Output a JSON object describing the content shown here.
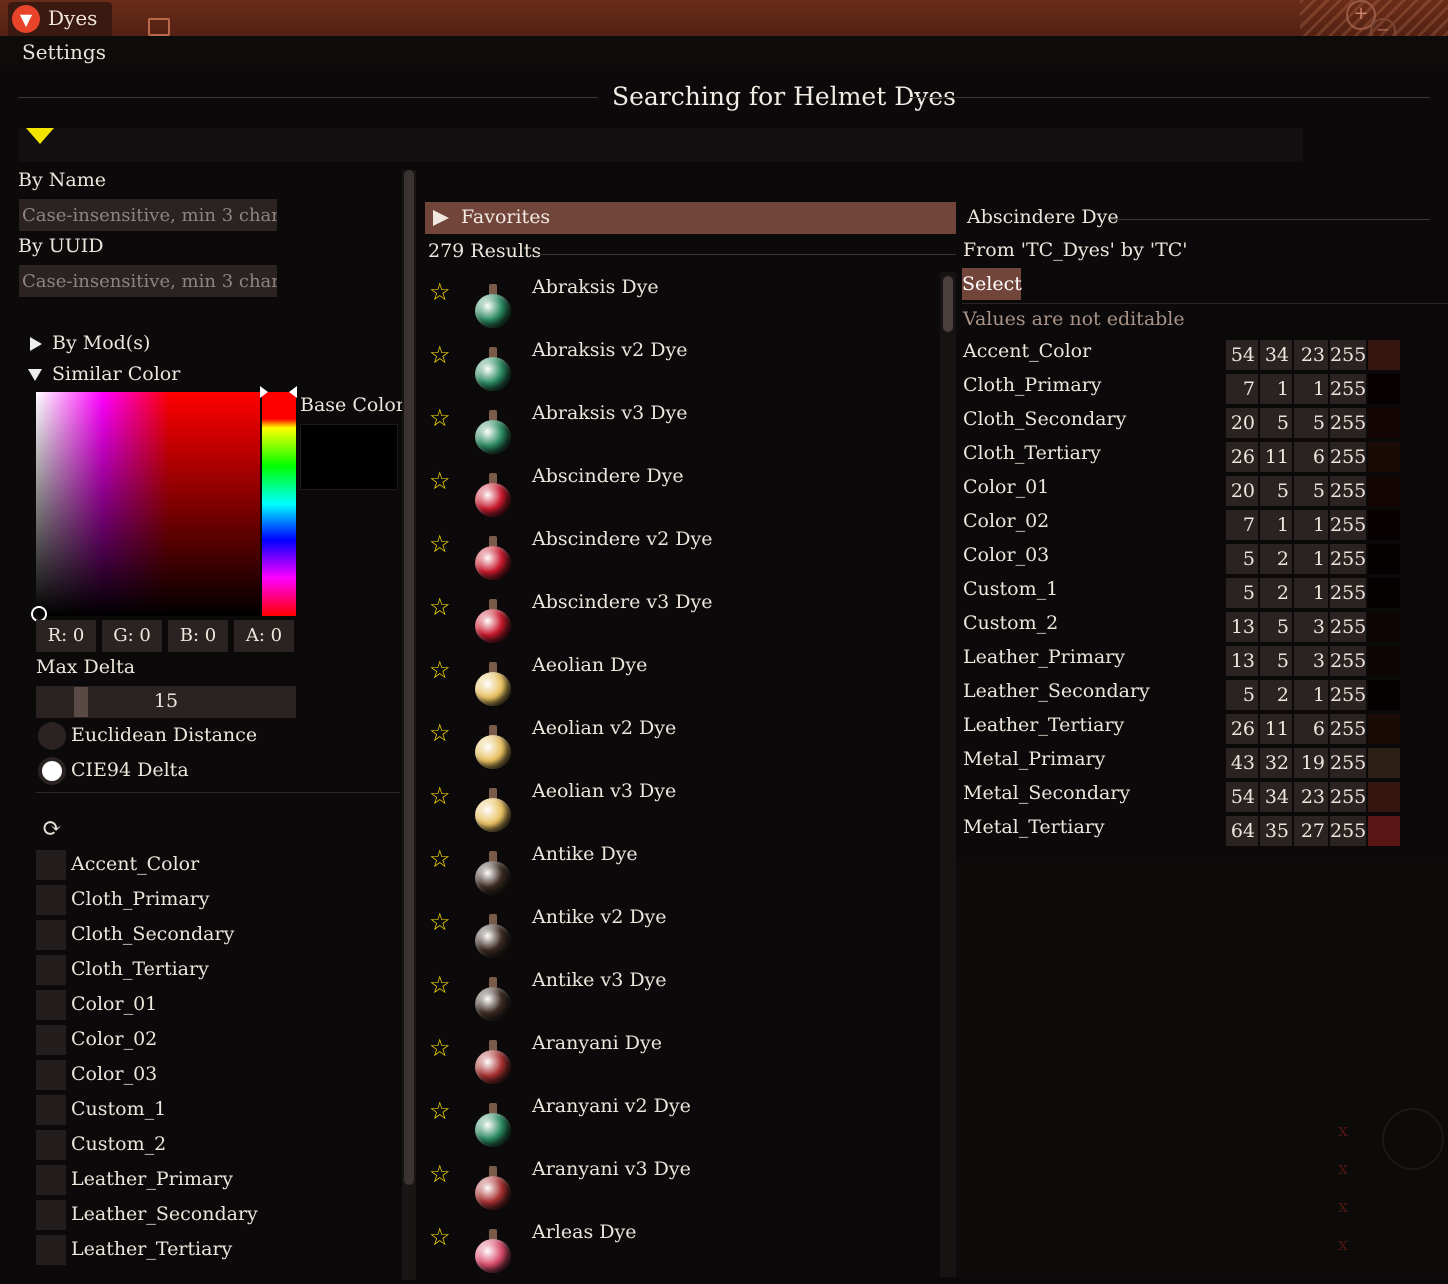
{
  "window": {
    "app_title": "Dyes",
    "menu": [
      "Settings"
    ]
  },
  "header": {
    "title": "Searching for Helmet Dyes"
  },
  "filters": {
    "by_name_label": "By Name",
    "by_name_placeholder": "Case-insensitive, min 3 chara",
    "by_uuid_label": "By UUID",
    "by_uuid_placeholder": "Case-insensitive, min 3 chara",
    "by_mods_label": "By Mod(s)",
    "similar_color_label": "Similar Color",
    "base_color_label": "Base Color",
    "base_color_hex": "#000000",
    "rgba": {
      "r": "R: 0",
      "g": "G: 0",
      "b": "B: 0",
      "a": "A: 0"
    },
    "max_delta_label": "Max Delta",
    "max_delta_value": "15",
    "distance_options": [
      {
        "label": "Euclidean Distance",
        "selected": false
      },
      {
        "label": "CIE94 Delta",
        "selected": true
      }
    ],
    "slot_checkboxes": [
      "Accent_Color",
      "Cloth_Primary",
      "Cloth_Secondary",
      "Cloth_Tertiary",
      "Color_01",
      "Color_02",
      "Color_03",
      "Custom_1",
      "Custom_2",
      "Leather_Primary",
      "Leather_Secondary",
      "Leather_Tertiary"
    ]
  },
  "results": {
    "favorites_label": "Favorites",
    "count_label": "279 Results",
    "items": [
      {
        "name": "Abraksis Dye",
        "color": "#2a8a62"
      },
      {
        "name": "Abraksis v2 Dye",
        "color": "#2a8a62"
      },
      {
        "name": "Abraksis v3 Dye",
        "color": "#2a8a62"
      },
      {
        "name": "Abscindere Dye",
        "color": "#c8182c"
      },
      {
        "name": "Abscindere v2 Dye",
        "color": "#c8182c"
      },
      {
        "name": "Abscindere v3 Dye",
        "color": "#c8182c"
      },
      {
        "name": "Aeolian Dye",
        "color": "#e8c060"
      },
      {
        "name": "Aeolian v2 Dye",
        "color": "#e8c060"
      },
      {
        "name": "Aeolian v3 Dye",
        "color": "#e8c060"
      },
      {
        "name": "Antike Dye",
        "color": "#3a2a22"
      },
      {
        "name": "Antike v2 Dye",
        "color": "#3a2a22"
      },
      {
        "name": "Antike v3 Dye",
        "color": "#3a2a22"
      },
      {
        "name": "Aranyani Dye",
        "color": "#a83030"
      },
      {
        "name": "Aranyani v2 Dye",
        "color": "#2a8a62"
      },
      {
        "name": "Aranyani v3 Dye",
        "color": "#a83030"
      },
      {
        "name": "Arleas Dye",
        "color": "#d84a6a"
      }
    ]
  },
  "detail": {
    "title": "Abscindere Dye",
    "source": "From 'TC_Dyes' by 'TC'",
    "select_label": "Select",
    "note": "Values are not editable",
    "params": [
      {
        "name": "Accent_Color",
        "rgba": [
          54,
          34,
          23,
          255
        ],
        "swatch": "#361710"
      },
      {
        "name": "Cloth_Primary",
        "rgba": [
          7,
          1,
          1,
          255
        ],
        "swatch": "#070101"
      },
      {
        "name": "Cloth_Secondary",
        "rgba": [
          20,
          5,
          5,
          255
        ],
        "swatch": "#140505"
      },
      {
        "name": "Cloth_Tertiary",
        "rgba": [
          26,
          11,
          6,
          255
        ],
        "swatch": "#1a0b06"
      },
      {
        "name": "Color_01",
        "rgba": [
          20,
          5,
          5,
          255
        ],
        "swatch": "#140505"
      },
      {
        "name": "Color_02",
        "rgba": [
          7,
          1,
          1,
          255
        ],
        "swatch": "#070101"
      },
      {
        "name": "Color_03",
        "rgba": [
          5,
          2,
          1,
          255
        ],
        "swatch": "#050201"
      },
      {
        "name": "Custom_1",
        "rgba": [
          5,
          2,
          1,
          255
        ],
        "swatch": "#050201"
      },
      {
        "name": "Custom_2",
        "rgba": [
          13,
          5,
          3,
          255
        ],
        "swatch": "#0d0503"
      },
      {
        "name": "Leather_Primary",
        "rgba": [
          13,
          5,
          3,
          255
        ],
        "swatch": "#0d0503"
      },
      {
        "name": "Leather_Secondary",
        "rgba": [
          5,
          2,
          1,
          255
        ],
        "swatch": "#050201"
      },
      {
        "name": "Leather_Tertiary",
        "rgba": [
          26,
          11,
          6,
          255
        ],
        "swatch": "#1a0b06"
      },
      {
        "name": "Metal_Primary",
        "rgba": [
          43,
          32,
          19,
          255
        ],
        "swatch": "#2b2013"
      },
      {
        "name": "Metal_Secondary",
        "rgba": [
          54,
          34,
          23,
          255
        ],
        "swatch": "#361710"
      },
      {
        "name": "Metal_Tertiary",
        "rgba": [
          64,
          35,
          27,
          255
        ],
        "swatch": "#5a1515"
      }
    ]
  },
  "colors": {
    "accent": "#72453b",
    "star": "#ffe100",
    "filter_icon": "#f4e500"
  },
  "icons": [
    "app-logo-icon",
    "filter-icon",
    "star-icon",
    "refresh-icon",
    "zoom-in-icon",
    "zoom-out-icon",
    "window-icon"
  ]
}
